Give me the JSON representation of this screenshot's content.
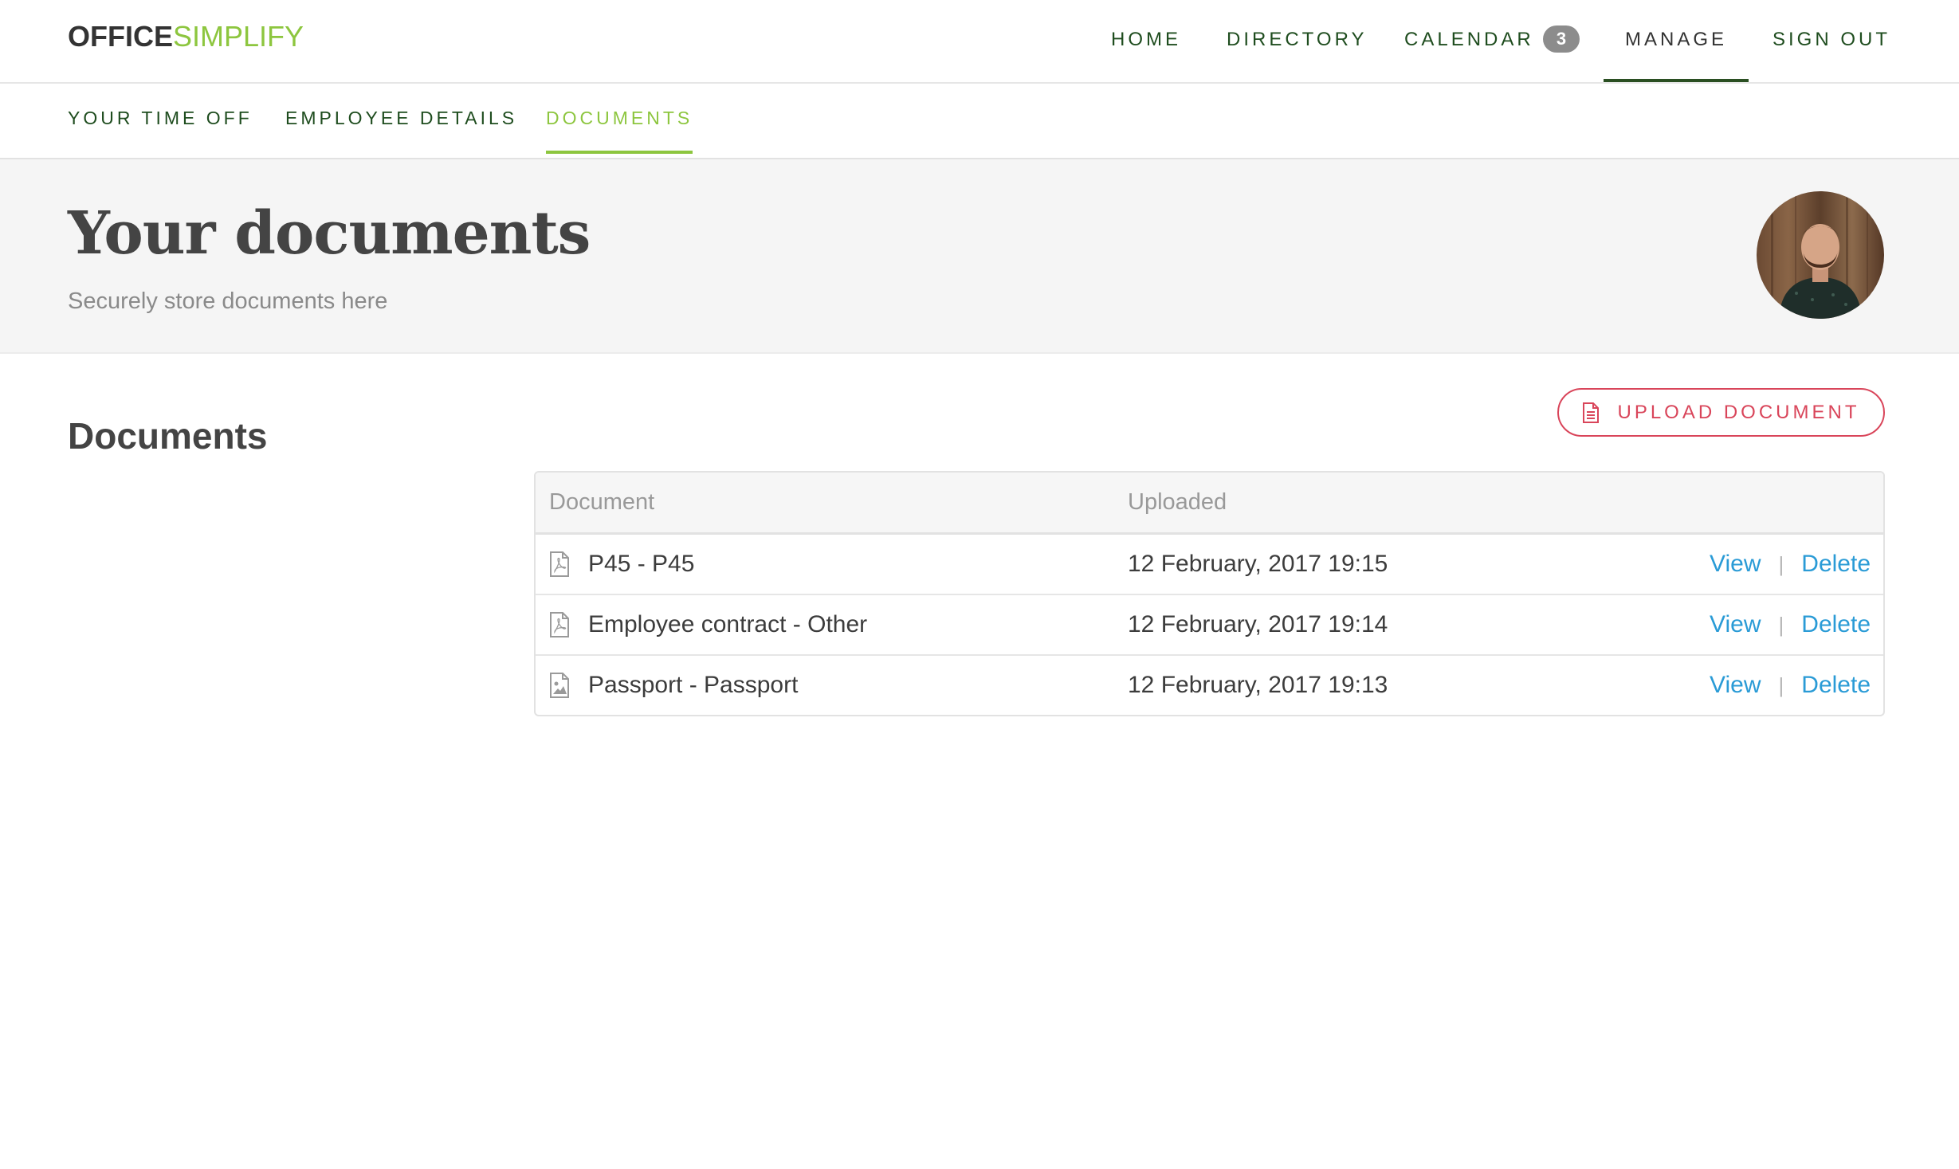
{
  "brand": {
    "part1": "OFFICE",
    "part2": "SIMPLIFY"
  },
  "nav": {
    "home": "HOME",
    "directory": "DIRECTORY",
    "calendar": "CALENDAR",
    "calendar_badge": "3",
    "manage": "MANAGE",
    "sign_out": "SIGN OUT"
  },
  "subnav": {
    "time_off": "YOUR TIME OFF",
    "employee_details": "EMPLOYEE DETAILS",
    "documents": "DOCUMENTS"
  },
  "hero": {
    "title": "Your documents",
    "subtitle": "Securely store documents here"
  },
  "section": {
    "title": "Documents"
  },
  "upload_button": "UPLOAD DOCUMENT",
  "table": {
    "headers": {
      "document": "Document",
      "uploaded": "Uploaded"
    },
    "rows": [
      {
        "name": "P45 - P45",
        "uploaded": "12 February, 2017 19:15",
        "icon": "pdf-file-icon",
        "view": "View",
        "delete": "Delete"
      },
      {
        "name": "Employee contract - Other",
        "uploaded": "12 February, 2017 19:14",
        "icon": "pdf-file-icon",
        "view": "View",
        "delete": "Delete"
      },
      {
        "name": "Passport - Passport",
        "uploaded": "12 February, 2017 19:13",
        "icon": "image-file-icon",
        "view": "View",
        "delete": "Delete"
      }
    ],
    "separator": "|"
  },
  "colors": {
    "brand_green": "#8dc63f",
    "nav_dark_green": "#1f4d1f",
    "accent_red": "#d9455a",
    "link_blue": "#2a9bd6"
  }
}
